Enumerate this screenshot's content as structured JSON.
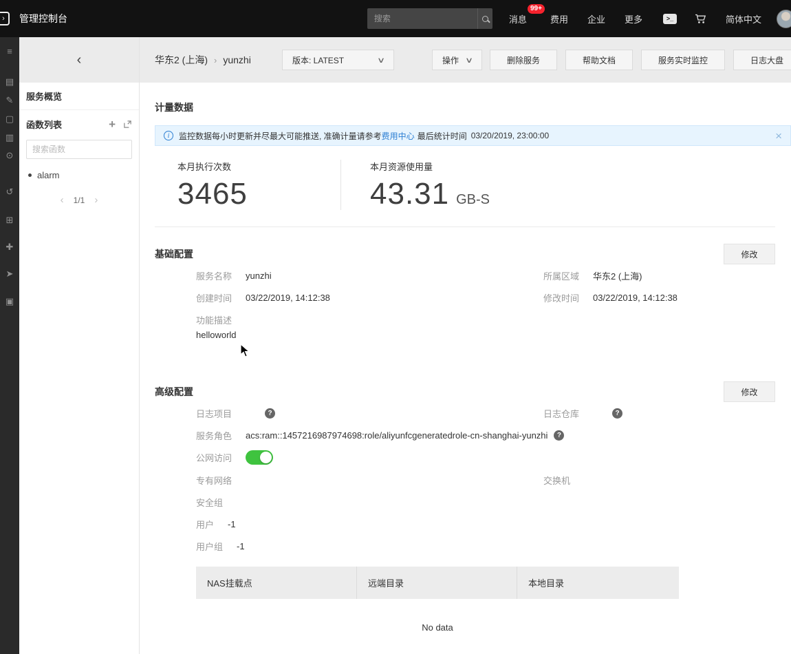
{
  "colors": {
    "topbar_bg": "#121212",
    "badge_red": "#f5222d",
    "link_blue": "#2d7fd3",
    "toggle_green": "#3fc33f",
    "notice_bg": "#e7f4fe",
    "header_bg": "#ebebeb"
  },
  "glyphs": {
    "caret_down": "∨",
    "close": "×",
    "info": "i",
    "help": "?",
    "chevron_left": "‹",
    "chevron_right": "›",
    "crumb_sep": "›",
    "plus": "+",
    "shell": ">_",
    "rail": [
      "≡",
      "▤",
      "✎",
      "▢",
      "▥",
      "⊙",
      "↺",
      "⊞",
      "✚",
      "➤",
      "▣"
    ]
  },
  "topbar": {
    "product_title": "管理控制台",
    "search_placeholder": "搜索",
    "messages_label": "消息",
    "messages_badge": "99+",
    "billing_label": "费用",
    "enterprise_label": "企业",
    "more_label": "更多",
    "language_label": "简体中文"
  },
  "sidebar": {
    "overview_label": "服务概览",
    "function_list_label": "函数列表",
    "search_placeholder": "搜索函数",
    "functions": [
      {
        "name": "alarm"
      }
    ],
    "pagination": "1/1"
  },
  "header": {
    "breadcrumb": {
      "region": "华东2 (上海)",
      "service": "yunzhi"
    },
    "version_button": "版本: LATEST",
    "action_button": "操作",
    "buttons": [
      "删除服务",
      "帮助文档",
      "服务实时监控",
      "日志大盘"
    ]
  },
  "metering": {
    "title": "计量数据",
    "notice": {
      "text": "监控数据每小时更新并尽最大可能推送, 准确计量请参考",
      "link": "费用中心",
      "suffix": "最后统计时间",
      "time": "03/20/2019, 23:00:00"
    },
    "stats": [
      {
        "label": "本月执行次数",
        "value": "3465",
        "unit": ""
      },
      {
        "label": "本月资源使用量",
        "value": "43.31",
        "unit": "GB-S"
      }
    ]
  },
  "basic_config": {
    "title": "基础配置",
    "modify_label": "修改",
    "service_name_label": "服务名称",
    "service_name_value": "yunzhi",
    "region_label": "所属区域",
    "region_value": "华东2 (上海)",
    "created_label": "创建时间",
    "created_value": "03/22/2019, 14:12:38",
    "modified_label": "修改时间",
    "modified_value": "03/22/2019, 14:12:38",
    "description_label": "功能描述",
    "description_value": "helloworld"
  },
  "advanced_config": {
    "title": "高级配置",
    "modify_label": "修改",
    "log_project_label": "日志项目",
    "log_store_label": "日志仓库",
    "service_role_label": "服务角色",
    "service_role_value": "acs:ram::1457216987974698:role/aliyunfcgeneratedrole-cn-shanghai-yunzhi",
    "internet_access_label": "公网访问",
    "vpc_label": "专有网络",
    "vswitch_label": "交换机",
    "security_group_label": "安全组",
    "user_label": "用户",
    "user_value": "-1",
    "group_label": "用户组",
    "group_value": "-1",
    "table": {
      "headers": [
        "NAS挂载点",
        "远端目录",
        "本地目录"
      ],
      "empty_text": "No data"
    }
  }
}
